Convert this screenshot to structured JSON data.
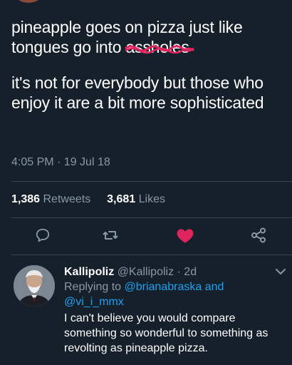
{
  "tweet": {
    "line1_before": "pineapple goes on pizza just like tongues go into ",
    "line1_scribbled": "assholes",
    "line2": "it's not for everybody but those who enjoy it are a bit more sophisticated",
    "timestamp": "4:05 PM · 19 Jul 18"
  },
  "stats": {
    "retweets_count": "1,386",
    "retweets_label": "Retweets",
    "likes_count": "3,681",
    "likes_label": "Likes"
  },
  "actions": {
    "icons": [
      "reply-icon",
      "retweet-icon",
      "heart-icon",
      "share-icon"
    ],
    "liked": true
  },
  "reply": {
    "name": "Kallipoliz",
    "handle": "@Kallipoliz",
    "time": "· 2d",
    "replying_prefix": "Replying to",
    "mention1": "@brianabraska",
    "and": "and",
    "mention2": "@vi_i_mmx",
    "text": "I can't believe you would compare something so wonderful to something as revolting as pineapple pizza."
  },
  "colors": {
    "background": "#15202b",
    "secondary_text": "#8899a6",
    "link": "#1da1f2",
    "like": "#e0245e",
    "scribble": "#e0245e"
  }
}
